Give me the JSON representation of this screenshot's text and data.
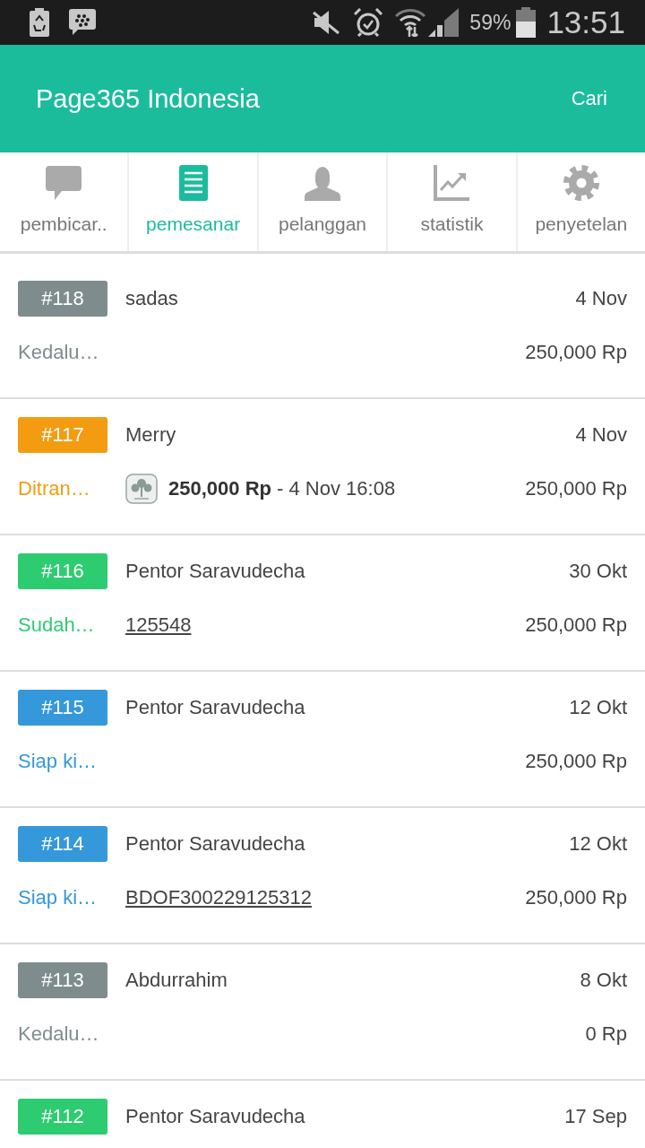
{
  "status_bar": {
    "battery_percent": "59%",
    "time": "13:51"
  },
  "app_bar": {
    "title": "Page365 Indonesia",
    "action": "Cari"
  },
  "tabs": [
    {
      "label": "pembicar..",
      "selected": false
    },
    {
      "label": "pemesanar",
      "selected": true
    },
    {
      "label": "pelanggan",
      "selected": false
    },
    {
      "label": "statistik",
      "selected": false
    },
    {
      "label": "penyetelan",
      "selected": false
    }
  ],
  "orders": [
    {
      "number": "#118",
      "color": "#7f8c8d",
      "customer": "sadas",
      "date": "4 Nov",
      "status": "Kedalu…",
      "amount": "250,000 Rp"
    },
    {
      "number": "#117",
      "color": "#f39c12",
      "customer": "Merry",
      "date": "4 Nov",
      "status": "Ditran…",
      "detail": {
        "kind": "payment",
        "text": "**250,000 Rp** - 4 Nov 16:08"
      },
      "amount": "250,000 Rp"
    },
    {
      "number": "#116",
      "color": "#2ecc71",
      "customer": "Pentor Saravudecha",
      "date": "30 Okt",
      "status": "Sudah…",
      "detail": {
        "kind": "tracking",
        "text": "125548"
      },
      "amount": "250,000 Rp"
    },
    {
      "number": "#115",
      "color": "#3498db",
      "customer": "Pentor Saravudecha",
      "date": "12 Okt",
      "status": "Siap ki…",
      "amount": "250,000 Rp"
    },
    {
      "number": "#114",
      "color": "#3498db",
      "customer": "Pentor Saravudecha",
      "date": "12 Okt",
      "status": "Siap ki…",
      "detail": {
        "kind": "tracking",
        "text": "BDOF300229125312"
      },
      "amount": "250,000 Rp"
    },
    {
      "number": "#113",
      "color": "#7f8c8d",
      "customer": "Abdurrahim",
      "date": "8 Okt",
      "status": "Kedalu…",
      "amount": "0 Rp"
    },
    {
      "number": "#112",
      "color": "#2ecc71",
      "customer": "Pentor Saravudecha",
      "date": "17 Sep"
    }
  ]
}
